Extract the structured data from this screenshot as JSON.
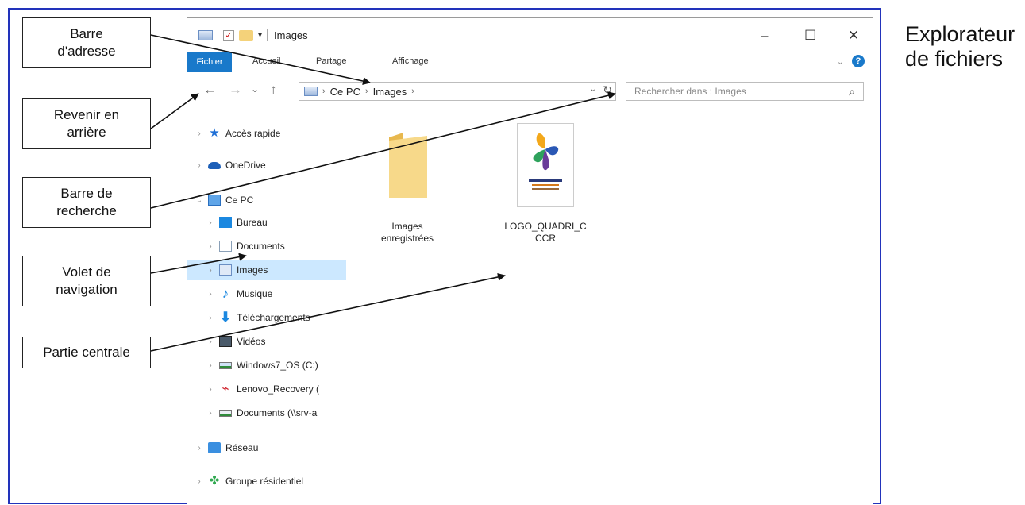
{
  "side_title": [
    "Explorateur",
    "de fichiers"
  ],
  "callouts": [
    {
      "id": "address",
      "text": "Barre\nd'adresse",
      "lines": [
        "Barre",
        "d'adresse"
      ]
    },
    {
      "id": "back",
      "lines": [
        "Revenir en",
        "arrière"
      ]
    },
    {
      "id": "search",
      "lines": [
        "Barre de",
        "recherche"
      ]
    },
    {
      "id": "navpane",
      "lines": [
        "Volet de",
        "navigation"
      ]
    },
    {
      "id": "central",
      "lines": [
        "Partie centrale"
      ]
    }
  ],
  "window": {
    "title": "Images",
    "controls": {
      "minimize": "–",
      "maximize": "☐",
      "close": "✕"
    },
    "ribbon_tabs": [
      "Fichier",
      "Accueil",
      "Partage",
      "Affichage"
    ],
    "address": {
      "nav": {
        "back": "←",
        "forward": "→",
        "recent": "⌄",
        "up": "↑"
      },
      "crumbs": [
        "Ce PC",
        "Images"
      ],
      "sep": "›"
    },
    "search_placeholder": "Rechercher dans : Images"
  },
  "nav_items": [
    {
      "label": "Accès rapide",
      "icon": "star-icon"
    },
    {
      "label": "OneDrive",
      "icon": "cloud-icon"
    },
    {
      "label": "Ce PC",
      "icon": "pc-icon",
      "expanded": true
    },
    {
      "label": "Bureau",
      "icon": "desktop-icon"
    },
    {
      "label": "Documents",
      "icon": "document-icon"
    },
    {
      "label": "Images",
      "icon": "pictures-icon",
      "selected": true
    },
    {
      "label": "Musique",
      "icon": "music-icon"
    },
    {
      "label": "Téléchargements",
      "icon": "download-icon"
    },
    {
      "label": "Vidéos",
      "icon": "video-icon"
    },
    {
      "label": "Windows7_OS (C:)",
      "icon": "drive-icon"
    },
    {
      "label": "Lenovo_Recovery (",
      "icon": "usb-icon"
    },
    {
      "label": "Documents (\\\\srv-a",
      "icon": "network-drive-icon"
    },
    {
      "label": "Réseau",
      "icon": "network-icon"
    },
    {
      "label": "Groupe résidentiel",
      "icon": "homegroup-icon"
    }
  ],
  "files": [
    {
      "lines": [
        "Images",
        "enregistrées"
      ],
      "icon": "folder-icon"
    },
    {
      "lines": [
        "LOGO_QUADRI_C",
        "CCR"
      ],
      "icon": "image-file-icon"
    }
  ],
  "colors": {
    "frame_border": "#2233bb",
    "file_tab": "#1979ca",
    "selection": "#cce8ff"
  }
}
